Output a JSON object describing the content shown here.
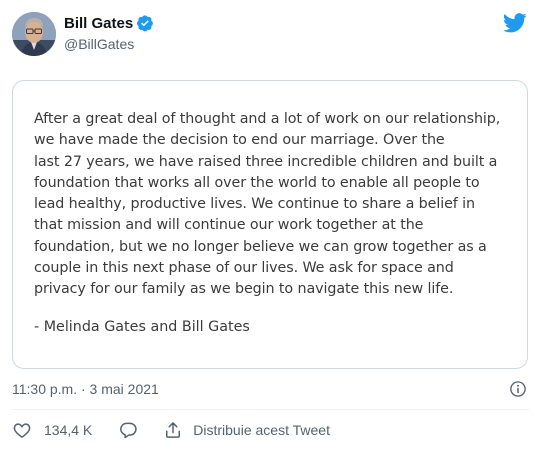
{
  "author": {
    "display_name": "Bill Gates",
    "handle": "@BillGates",
    "verified": true
  },
  "statement": {
    "lines": [
      "After a great deal of thought and a lot of work on our relationship,",
      "we have made the decision to end our marriage. Over the",
      "last 27 years, we have raised three incredible children and built a",
      "foundation that works all over the world to enable all people to",
      "lead healthy, productive lives. We continue to share a belief in",
      "that mission and will continue our work together at the",
      "foundation, but we no longer believe we can grow together as a",
      "couple in this next phase of our lives. We ask for space and",
      "privacy for our family as we begin to navigate this new life."
    ],
    "signature": "- Melinda Gates and Bill Gates"
  },
  "meta": {
    "timestamp": "11:30 p.m. · 3 mai 2021"
  },
  "actions": {
    "like_count": "134,4 K",
    "share_label": "Distribuie acest Tweet"
  },
  "colors": {
    "brand_blue": "#1d9bf0",
    "secondary_text": "#536471",
    "border": "#cfd9de"
  },
  "icons": {
    "logo": "twitter-bird-icon",
    "verified": "verified-badge-icon",
    "info": "info-icon",
    "like": "heart-icon",
    "reply": "reply-bubble-icon",
    "share": "share-icon"
  }
}
